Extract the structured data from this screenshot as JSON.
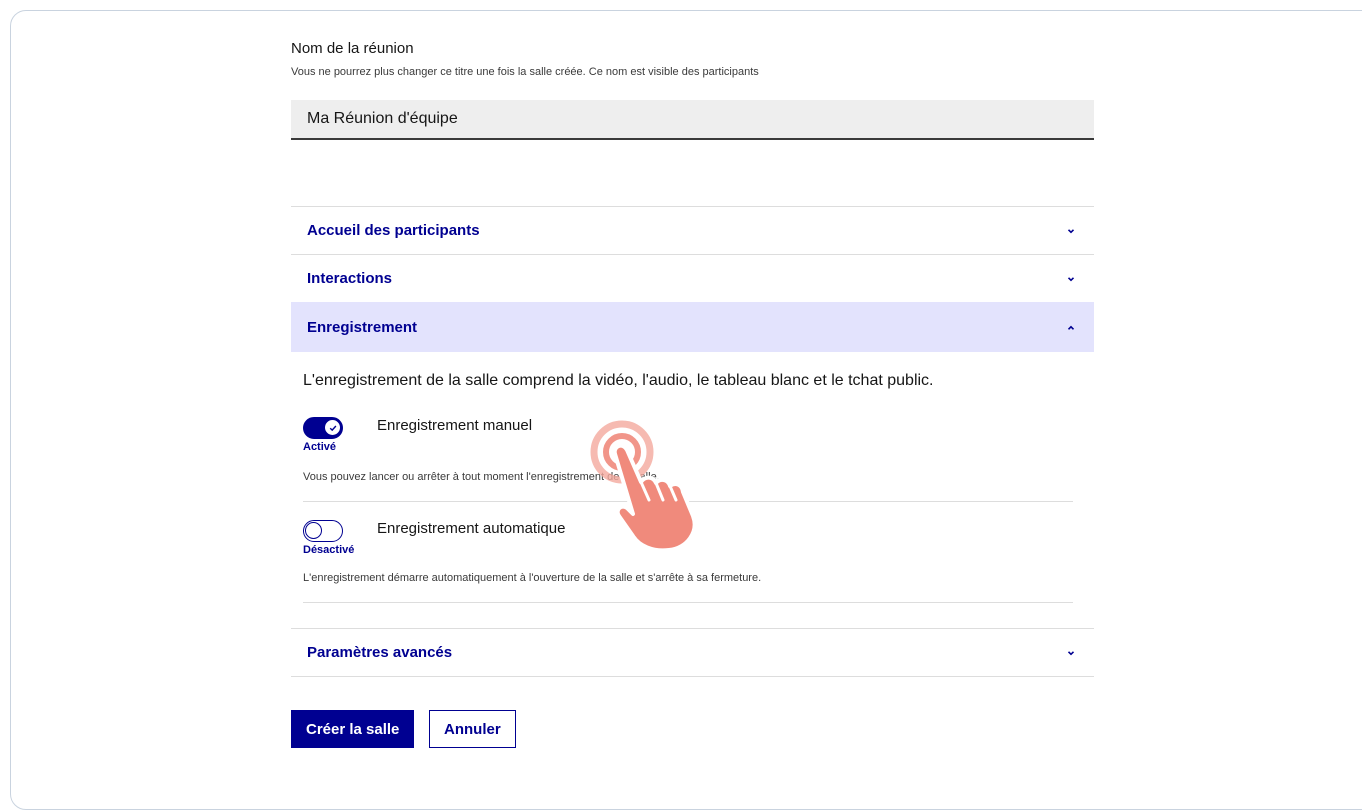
{
  "form": {
    "name_label": "Nom de la réunion",
    "name_hint": "Vous ne pourrez plus changer ce titre une fois la salle créée. Ce nom est visible des participants",
    "name_value": "Ma Réunion d'équipe"
  },
  "accordion": {
    "welcome": "Accueil des participants",
    "interactions": "Interactions",
    "recording": "Enregistrement",
    "advanced": "Paramètres avancés"
  },
  "recording": {
    "description": "L'enregistrement de la salle comprend la vidéo, l'audio, le tableau blanc et le tchat public.",
    "manual": {
      "label": "Enregistrement manuel",
      "state": "Activé",
      "enabled": true,
      "hint": "Vous pouvez lancer ou arrêter à tout moment l'enregistrement de la salle."
    },
    "automatic": {
      "label": "Enregistrement automatique",
      "state": "Désactivé",
      "enabled": false,
      "hint": "L'enregistrement démarre automatiquement à l'ouverture de la salle et s'arrête à sa fermeture."
    }
  },
  "actions": {
    "create": "Créer la salle",
    "cancel": "Annuler"
  },
  "colors": {
    "primary": "#000091",
    "open_section_bg": "#e3e3fd",
    "pointer": "#f08a7c"
  },
  "icons": {
    "collapsed": "chevron-down-icon",
    "expanded": "chevron-up-icon",
    "check": "check-icon",
    "pointer": "hand-pointer-icon"
  }
}
